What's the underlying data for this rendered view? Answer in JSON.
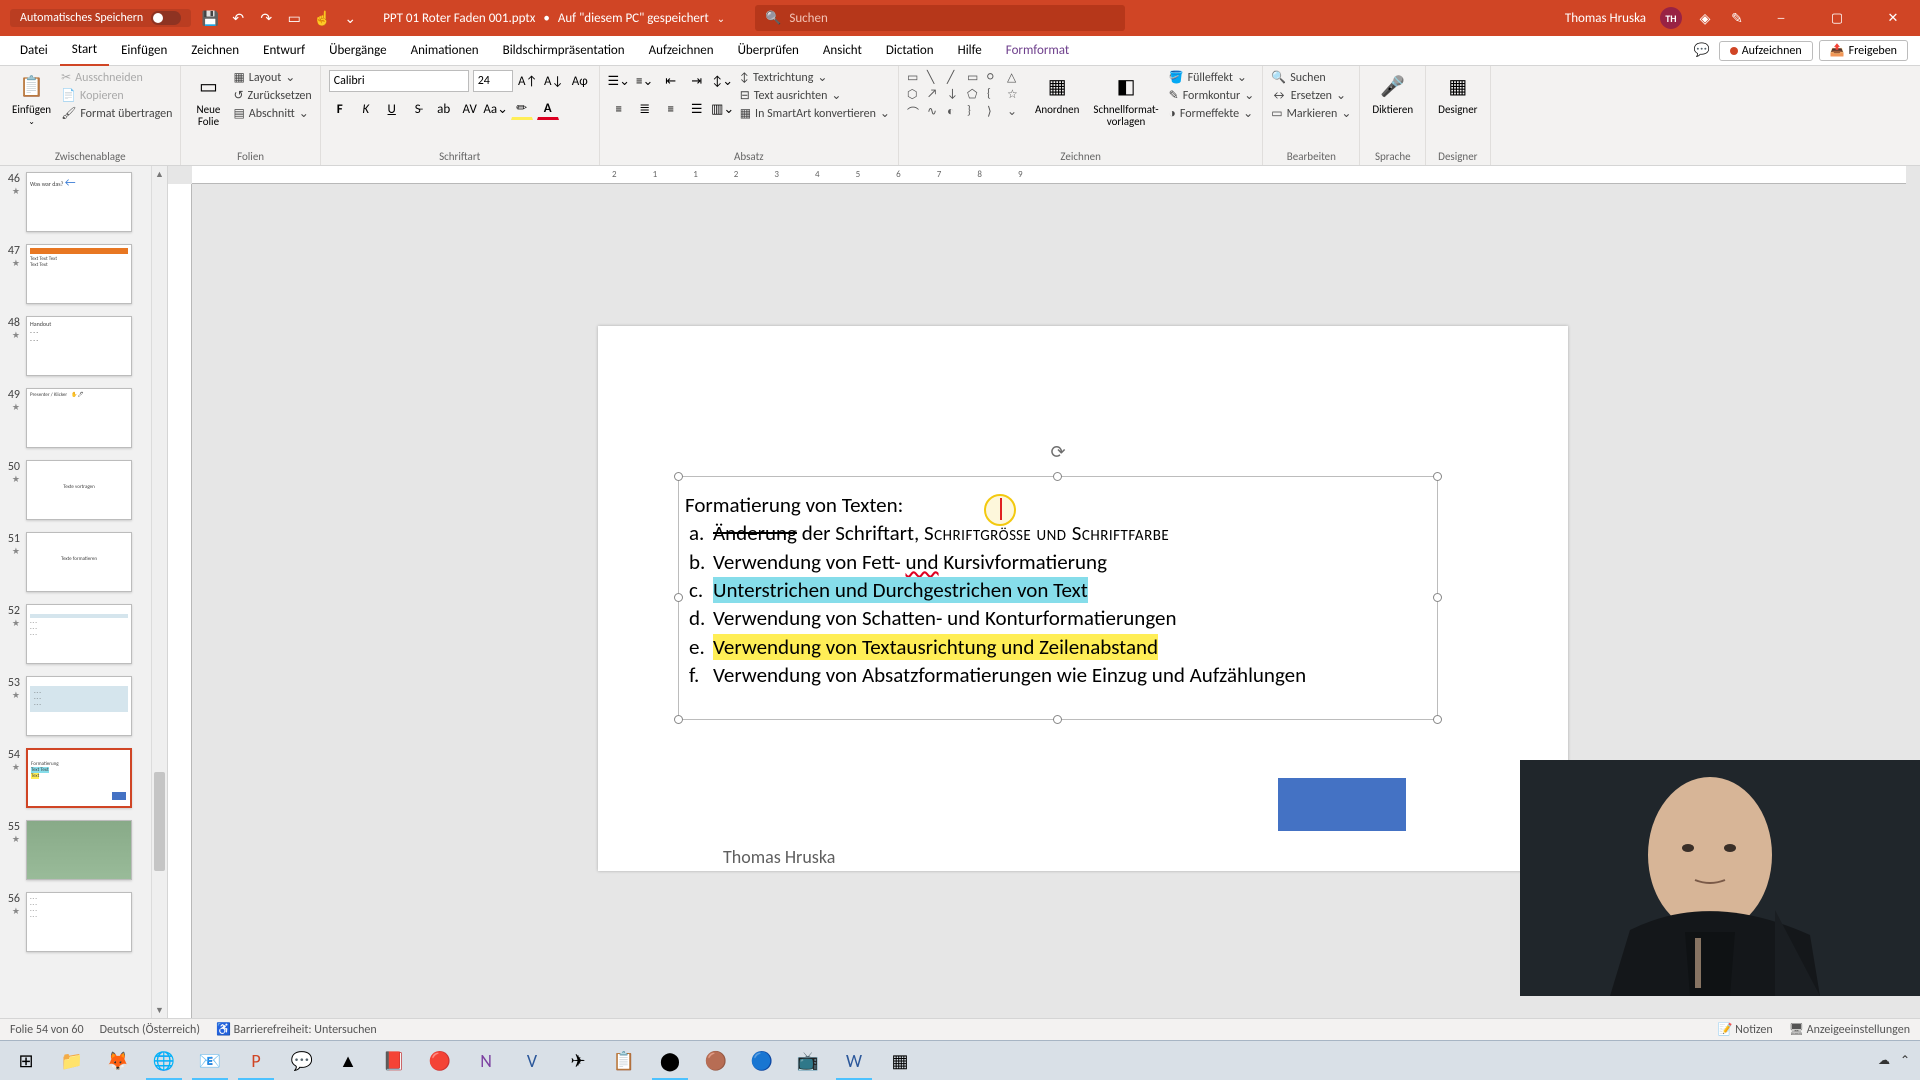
{
  "titlebar": {
    "autosave": "Automatisches Speichern",
    "filename": "PPT 01 Roter Faden 001.pptx",
    "saved_location": "Auf \"diesem PC\" gespeichert",
    "search_placeholder": "Suchen",
    "user_name": "Thomas Hruska",
    "user_initials": "TH"
  },
  "tabs": {
    "file": "Datei",
    "home": "Start",
    "insert": "Einfügen",
    "draw": "Zeichnen",
    "design": "Entwurf",
    "transitions": "Übergänge",
    "animations": "Animationen",
    "slideshow": "Bildschirmpräsentation",
    "record": "Aufzeichnen",
    "review": "Überprüfen",
    "view": "Ansicht",
    "dictation": "Dictation",
    "help": "Hilfe",
    "format": "Formformat",
    "record_btn": "Aufzeichnen",
    "share_btn": "Freigeben"
  },
  "ribbon": {
    "clipboard": {
      "label": "Zwischenablage",
      "paste": "Einfügen",
      "cut": "Ausschneiden",
      "copy": "Kopieren",
      "painter": "Format übertragen"
    },
    "slides": {
      "label": "Folien",
      "new": "Neue\nFolie",
      "layout": "Layout",
      "reset": "Zurücksetzen",
      "section": "Abschnitt"
    },
    "font": {
      "label": "Schriftart",
      "name": "Calibri",
      "size": "24"
    },
    "paragraph": {
      "label": "Absatz",
      "textdir": "Textrichtung",
      "align": "Text ausrichten",
      "smartart": "In SmartArt konvertieren"
    },
    "drawing": {
      "label": "Zeichnen",
      "arrange": "Anordnen",
      "styles": "Schnellformat-\nvorlagen",
      "fill": "Fülleffekt",
      "outline": "Formkontur",
      "effects": "Formeffekte"
    },
    "editing": {
      "label": "Bearbeiten",
      "find": "Suchen",
      "replace": "Ersetzen",
      "select": "Markieren"
    },
    "voice": {
      "label": "Sprache",
      "dictate": "Diktieren"
    },
    "designer": {
      "label": "Designer",
      "btn": "Designer"
    }
  },
  "thumbs": [
    {
      "num": "46"
    },
    {
      "num": "47"
    },
    {
      "num": "48"
    },
    {
      "num": "49"
    },
    {
      "num": "50"
    },
    {
      "num": "51"
    },
    {
      "num": "52"
    },
    {
      "num": "53"
    },
    {
      "num": "54"
    },
    {
      "num": "55"
    },
    {
      "num": "56"
    }
  ],
  "slide": {
    "title": "Formatierung von Texten:",
    "a1": "a.",
    "a_strike": "Änderung",
    "a_mid": " der Schriftart, ",
    "a_caps": "Schriftgröße und Schriftfarbe",
    "b1": "b.",
    "b_pre": "Verwendung von Fett- ",
    "b_mid": "und",
    "b_post": " Kursivformatierung",
    "c1": "c.",
    "c_hl": "Unterstrichen und Durchgestrichen von Text",
    "d1": "d.",
    "d": "Verwendung von Schatten- und Konturformatierungen",
    "e1": "e.",
    "e_hl": "Verwendung von Textausrichtung und Zeilenabstand",
    "f1": "f.",
    "f": "Verwendung von Absatzformatierungen wie Einzug und Aufzählungen",
    "footer": "Thomas Hruska"
  },
  "status": {
    "slide": "Folie 54 von 60",
    "lang": "Deutsch (Österreich)",
    "access": "Barrierefreiheit: Untersuchen",
    "notes": "Notizen",
    "display": "Anzeigeeinstellungen"
  }
}
